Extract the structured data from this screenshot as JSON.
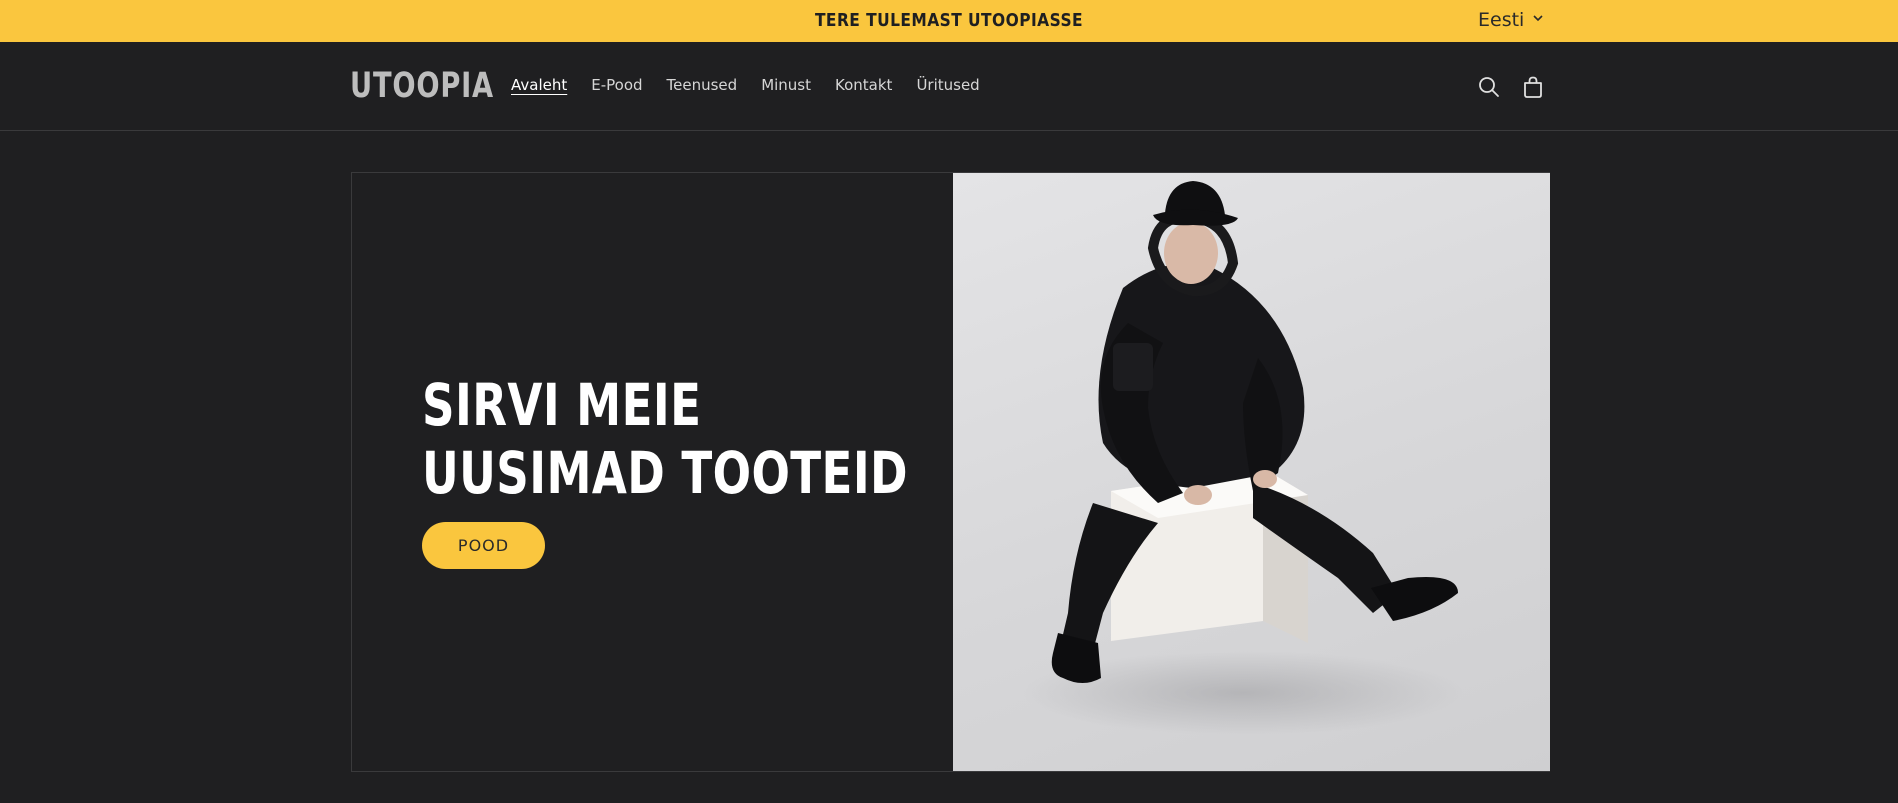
{
  "announcement": {
    "text": "TERE TULEMAST UTOOPIASSE"
  },
  "language": {
    "selected": "Eesti"
  },
  "header": {
    "logo": "UTOOPIA",
    "nav": [
      "Avaleht",
      "E-Pood",
      "Teenused",
      "Minust",
      "Kontakt",
      "Üritused"
    ],
    "active_nav": "Avaleht",
    "icons": [
      "search-icon",
      "cart-icon"
    ]
  },
  "hero": {
    "heading_line1": "SIRVI MEIE",
    "heading_line2": "UUSIMAD TOOTEID",
    "button_label": "POOD",
    "image": "person-sitting-on-white-cube"
  },
  "colors": {
    "accent": "#fac63e",
    "background": "#1f1f21",
    "text": "#ffffff"
  }
}
